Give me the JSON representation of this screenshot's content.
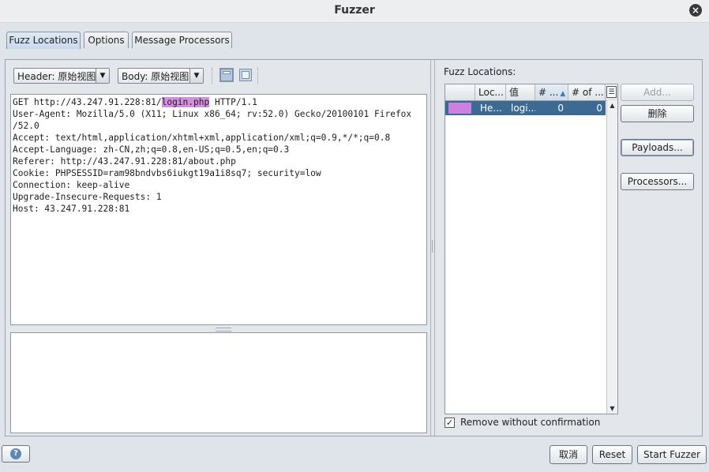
{
  "window": {
    "title": "Fuzzer"
  },
  "tabs": [
    {
      "label": "Fuzz Locations",
      "active": true
    },
    {
      "label": "Options",
      "active": false
    },
    {
      "label": "Message Processors",
      "active": false
    }
  ],
  "editor": {
    "header_view": "Header: 原始视图",
    "body_view": "Body: 原始视图",
    "request": {
      "line1_pre": "GET http://43.247.91.228:81/",
      "line1_highlight": "login.php",
      "line1_post": " HTTP/1.1",
      "lines": [
        "User-Agent: Mozilla/5.0 (X11; Linux x86_64; rv:52.0) Gecko/20100101 Firefox",
        "/52.0",
        "Accept: text/html,application/xhtml+xml,application/xml;q=0.9,*/*;q=0.8",
        "Accept-Language: zh-CN,zh;q=0.8,en-US;q=0.5,en;q=0.3",
        "Referer: http://43.247.91.228:81/about.php",
        "Cookie: PHPSESSID=ram98bndvbs6iukgt19a1i8sq7; security=low",
        "Connection: keep-alive",
        "Upgrade-Insecure-Requests: 1",
        "Host: 43.247.91.228:81"
      ]
    },
    "highlight_color": "#d48ee0"
  },
  "fuzz_locations": {
    "label": "Fuzz Locations:",
    "columns": [
      "",
      "Loc...",
      "值",
      "# ...",
      "# of ..."
    ],
    "rows": [
      {
        "color": "#cc80e0",
        "location": "He...",
        "value": "logi...",
        "count": "0",
        "count_of": "0"
      }
    ],
    "buttons": {
      "add": "Add...",
      "delete": "删除",
      "payloads": "Payloads...",
      "processors": "Processors..."
    },
    "remove_without_confirmation": {
      "label": "Remove without confirmation",
      "checked": true
    }
  },
  "footer": {
    "cancel": "取消",
    "reset": "Reset",
    "start": "Start Fuzzer"
  },
  "colors": {
    "selection": "#3d6a93",
    "accent": "#5d87b8"
  }
}
